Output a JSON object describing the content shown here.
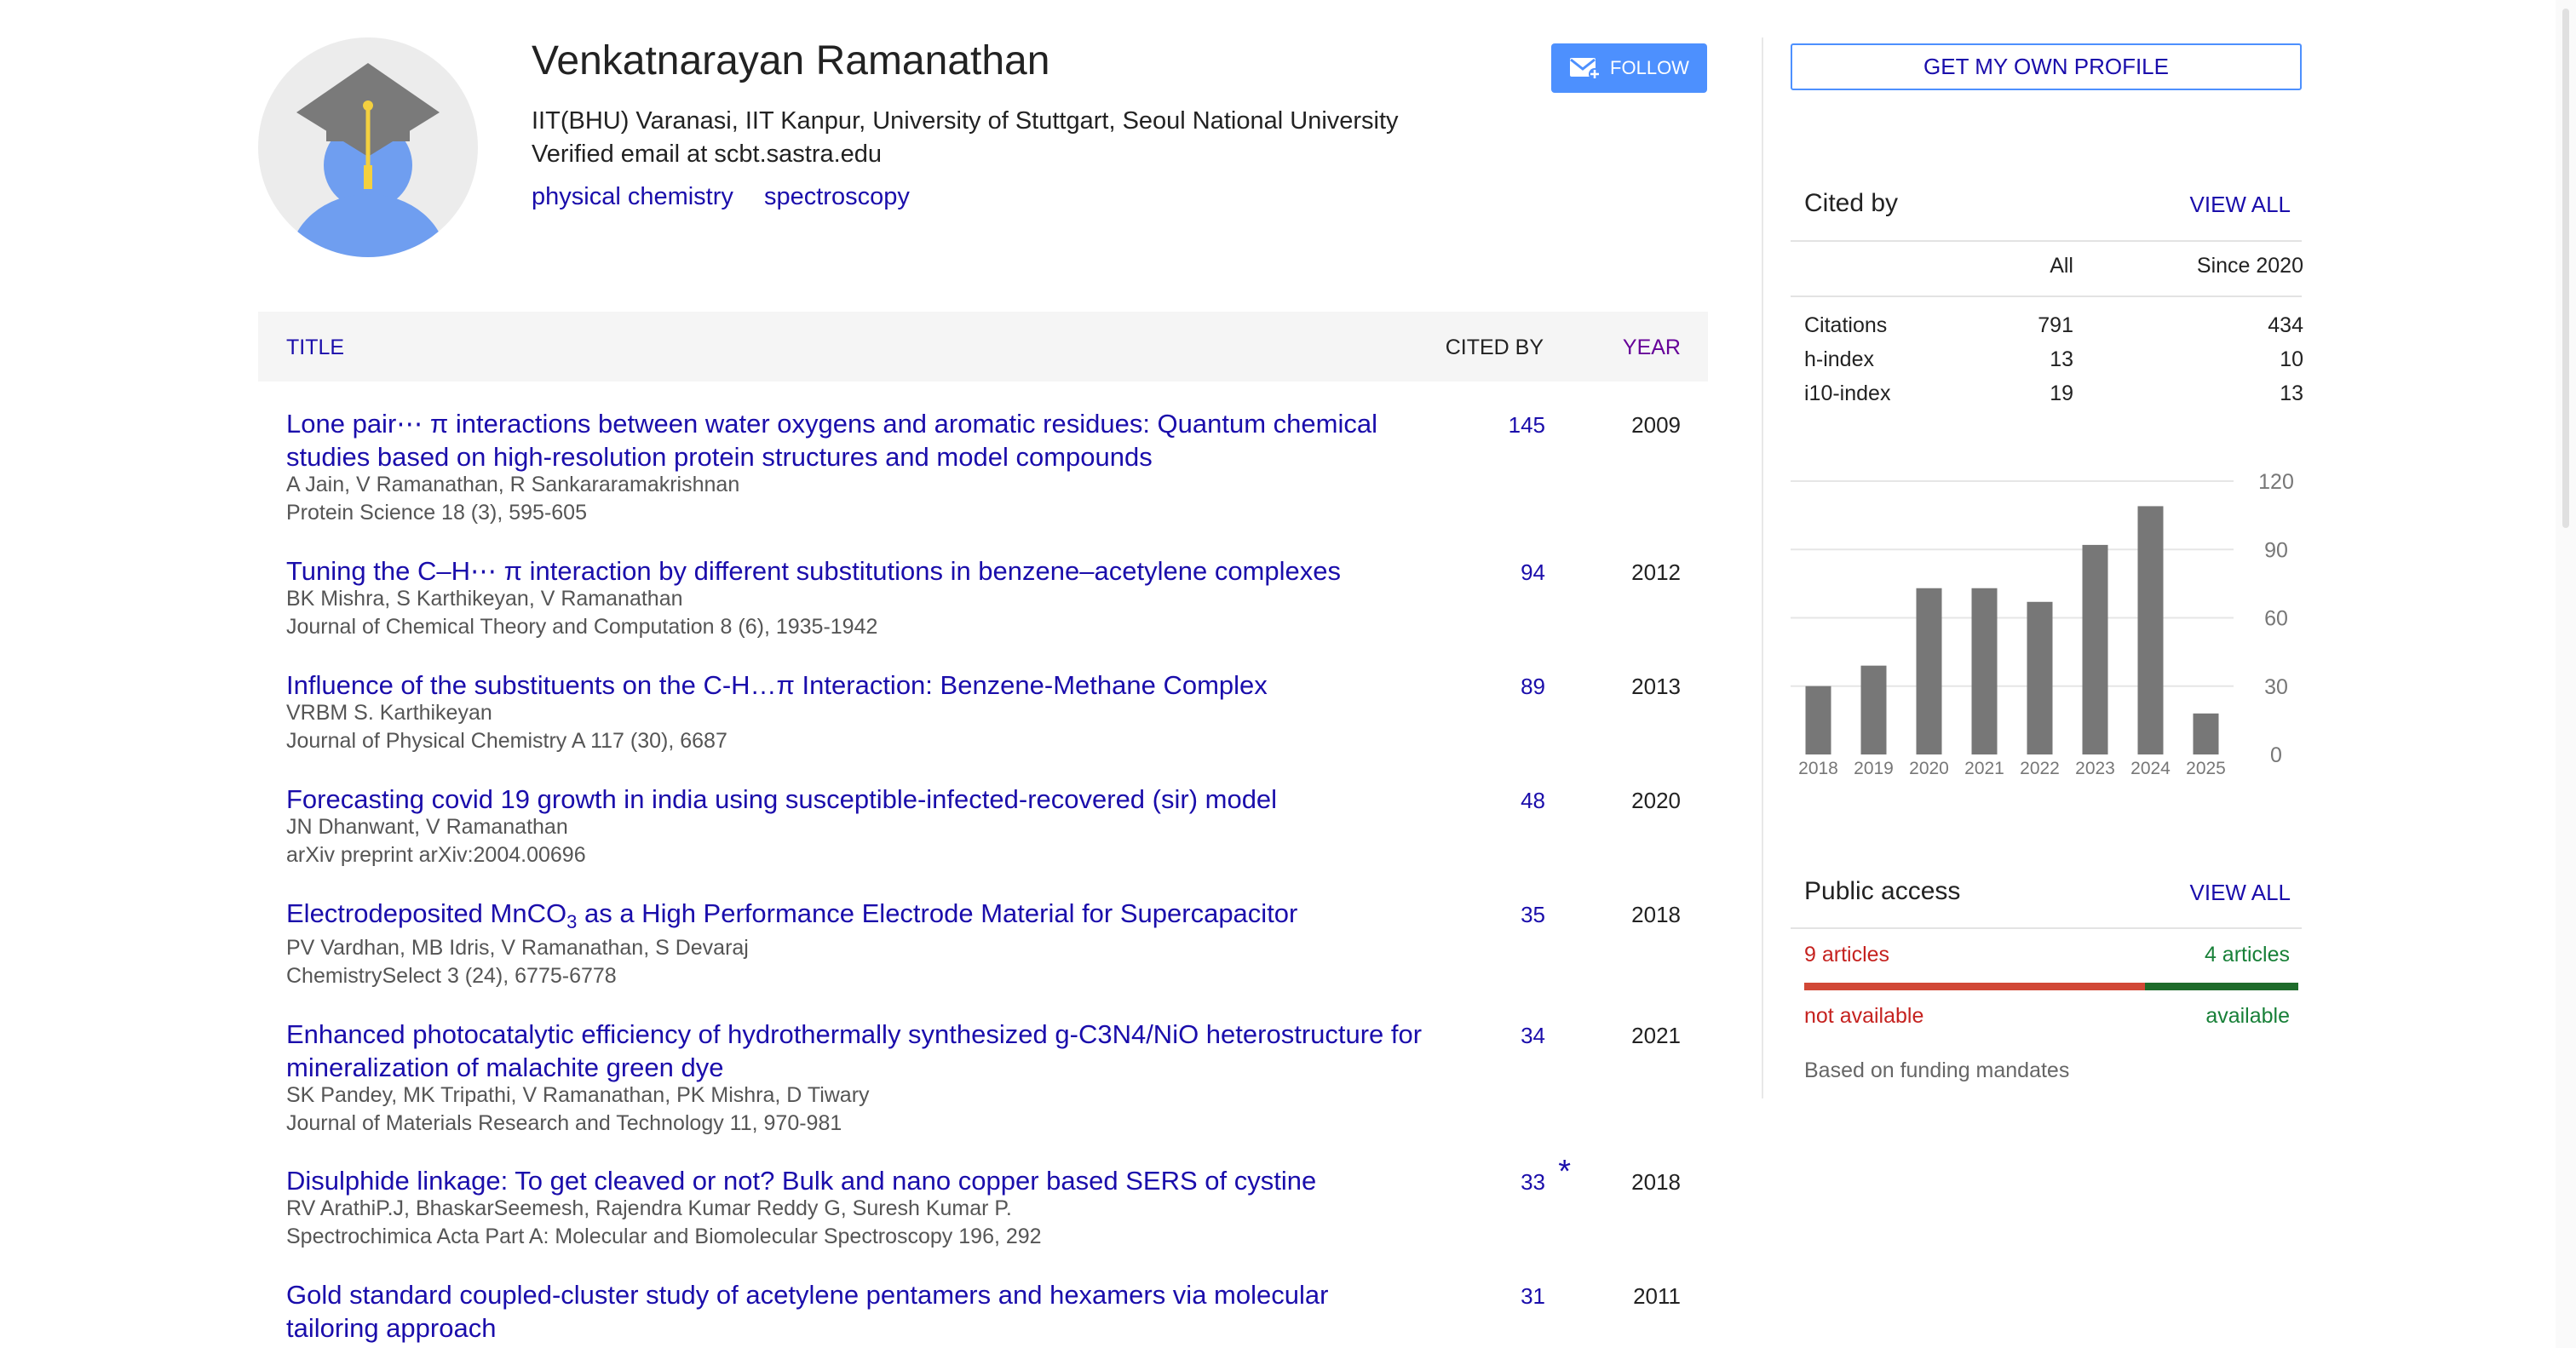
{
  "profile": {
    "name": "Venkatnarayan Ramanathan",
    "affiliation": "IIT(BHU) Varanasi, IIT Kanpur, University of Stuttgart, Seoul National University",
    "email": "Verified email at scbt.sastra.edu",
    "interests": [
      "physical chemistry",
      "spectroscopy"
    ],
    "follow_label": "FOLLOW"
  },
  "table": {
    "headers": {
      "title": "TITLE",
      "cited_by": "CITED BY",
      "year": "YEAR"
    },
    "rows": [
      {
        "title": "Lone pair⋯ π interactions between water oxygens and aromatic residues: Quantum chemical studies based on high-resolution protein structures and model compounds",
        "authors": "A Jain, V Ramanathan, R Sankararamakrishnan",
        "venue": "Protein Science 18 (3), 595-605",
        "cited": "145",
        "year": "2009"
      },
      {
        "title": "Tuning the C–H⋯ π interaction by different substitutions in benzene–acetylene complexes",
        "authors": "BK Mishra, S Karthikeyan, V Ramanathan",
        "venue": "Journal of Chemical Theory and Computation 8 (6), 1935-1942",
        "cited": "94",
        "year": "2012"
      },
      {
        "title": "Influence of the substituents on the C-H…π Interaction: Benzene-Methane Complex",
        "authors": "VRBM S. Karthikeyan",
        "venue": "Journal of Physical Chemistry A 117 (30), 6687",
        "cited": "89",
        "year": "2013"
      },
      {
        "title": "Forecasting covid 19 growth in india using susceptible-infected-recovered (sir) model",
        "authors": "JN Dhanwant, V Ramanathan",
        "venue": "arXiv preprint arXiv:2004.00696",
        "cited": "48",
        "year": "2020"
      },
      {
        "title_pre": "Electrodeposited MnCO",
        "title_sub": "3",
        "title_post": " as a High Performance Electrode Material for Supercapacitor",
        "authors": "PV Vardhan, MB Idris, V Ramanathan, S Devaraj",
        "venue": "ChemistrySelect 3 (24), 6775-6778",
        "cited": "35",
        "year": "2018"
      },
      {
        "title": "Enhanced photocatalytic efficiency of hydrothermally synthesized g-C3N4/NiO heterostructure for mineralization of malachite green dye",
        "authors": "SK Pandey, MK Tripathi, V Ramanathan, PK Mishra, D Tiwary",
        "venue": "Journal of Materials Research and Technology 11, 970-981",
        "cited": "34",
        "year": "2021"
      },
      {
        "title": "Disulphide linkage: To get cleaved or not? Bulk and nano copper based SERS of cystine",
        "authors": "RV ArathiP.J, BhaskarSeemesh, Rajendra Kumar Reddy G, Suresh Kumar P.",
        "venue": "Spectrochimica Acta Part A: Molecular and Biomolecular Spectroscopy 196, 292",
        "cited": "33",
        "star": "*",
        "year": "2018"
      },
      {
        "title": "Gold standard coupled-cluster study of acetylene pentamers and hexamers via molecular tailoring approach",
        "authors": "",
        "venue": "",
        "cited": "31",
        "year": "2011"
      }
    ]
  },
  "sidebar": {
    "own_profile_label": "GET MY OWN PROFILE",
    "cited_by": {
      "title": "Cited by",
      "view_all": "VIEW ALL",
      "col_all": "All",
      "col_since": "Since 2020",
      "rows": [
        {
          "label": "Citations",
          "all": "791",
          "since": "434"
        },
        {
          "label": "h-index",
          "all": "13",
          "since": "10"
        },
        {
          "label": "i10-index",
          "all": "19",
          "since": "13"
        }
      ]
    },
    "public_access": {
      "title": "Public access",
      "view_all": "VIEW ALL",
      "not_available_count": "9 articles",
      "available_count": "4 articles",
      "not_available_fraction": 0.69,
      "not_available_label": "not available",
      "available_label": "available",
      "note": "Based on funding mandates"
    }
  },
  "chart_data": {
    "type": "bar",
    "categories": [
      "2018",
      "2019",
      "2020",
      "2021",
      "2022",
      "2023",
      "2024",
      "2025"
    ],
    "values": [
      30,
      39,
      73,
      73,
      67,
      92,
      109,
      18
    ],
    "ylim": [
      0,
      120
    ],
    "yticks": [
      "0",
      "30",
      "60",
      "90",
      "120"
    ],
    "grid": true,
    "bar_color": "#777777"
  },
  "colors": {
    "link": "#1a0dab",
    "accent": "#4d90fe",
    "red": "#d14836",
    "green": "#1e6b2a"
  }
}
